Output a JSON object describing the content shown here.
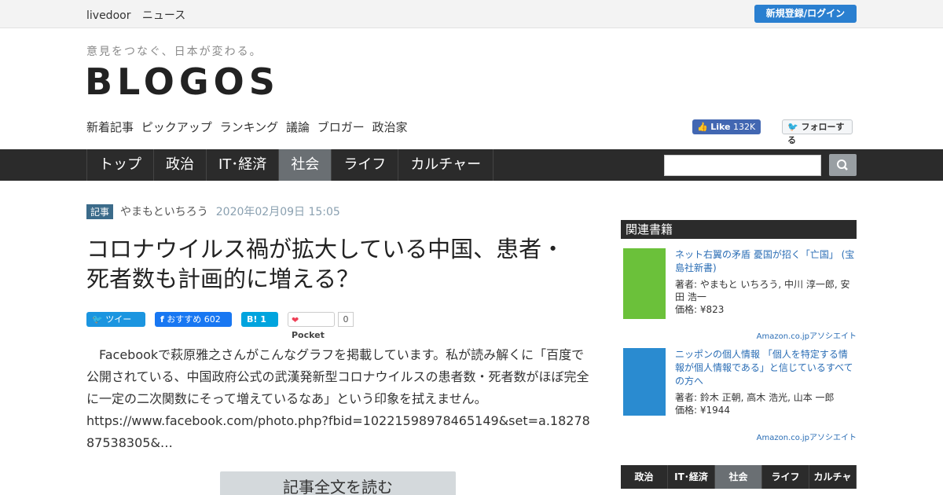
{
  "topbar": {
    "brand": "livedoor",
    "service": "ニュース",
    "login_label": "新規登録/ログイン"
  },
  "header": {
    "tagline": "意見をつなぐ、日本が変わる。",
    "logo": "BLOGOS",
    "subnav": [
      "新着記事",
      "ピックアップ",
      "ランキング",
      "議論",
      "ブロガー",
      "政治家"
    ],
    "fb_like_label": "Like",
    "fb_like_count": "132K",
    "tw_follow_label": "フォローする"
  },
  "mainnav": {
    "tabs": [
      "トップ",
      "政治",
      "IT･経済",
      "社会",
      "ライフ",
      "カルチャー"
    ],
    "active": "社会"
  },
  "article": {
    "badge": "記事",
    "author": "やまもといちろう",
    "date": "2020年02月09日 15:05",
    "title": "コロナウイルス禍が拡大している中国、患者・死者数も計画的に増える？",
    "share": {
      "tweet": "ツイート",
      "fb": "おすすめ",
      "fb_count": "602",
      "hatena_count": "1",
      "pocket": "Pocket",
      "pocket_count": "0"
    },
    "body": "Facebookで萩原雅之さんがこんなグラフを掲載しています。私が読み解くに「百度で公開されている、中国政府公式の武漢発新型コロナウイルスの患者数・死者数がほぼ完全に一定の二次関数にそって増えているなあ」という印象を拭えません。",
    "url": "https://www.facebook.com/photo.php?fbid=10221598978465149&set=a.1827887538305&…",
    "read_more": "記事全文を読む"
  },
  "sidebar": {
    "heading": "関連書籍",
    "books": [
      {
        "title": "ネット右翼の矛盾 憂国が招く「亡国」 (宝島社新書)",
        "author": "著者: やまもと いちろう, 中川 淳一郎, 安田 浩一",
        "price": "価格: ¥823",
        "cover_color": "#6bc13a"
      },
      {
        "title": "ニッポンの個人情報 「個人を特定する情報が個人情報である」と信じているすべての方へ",
        "author": "著者: 鈴木 正朝, 高木 浩光, 山本 一郎",
        "price": "価格: ¥1944",
        "cover_color": "#2a8bd0"
      }
    ],
    "amazon_label": "Amazon.co.jpアソシエイト",
    "tabs": [
      "政治",
      "IT･経済",
      "社会",
      "ライフ",
      "カルチャー"
    ],
    "active_tab": "社会"
  },
  "colors": {
    "nav_bg": "#2b2b2b",
    "accent_blue": "#2a7fd0",
    "active_tab": "#6a6f73"
  }
}
